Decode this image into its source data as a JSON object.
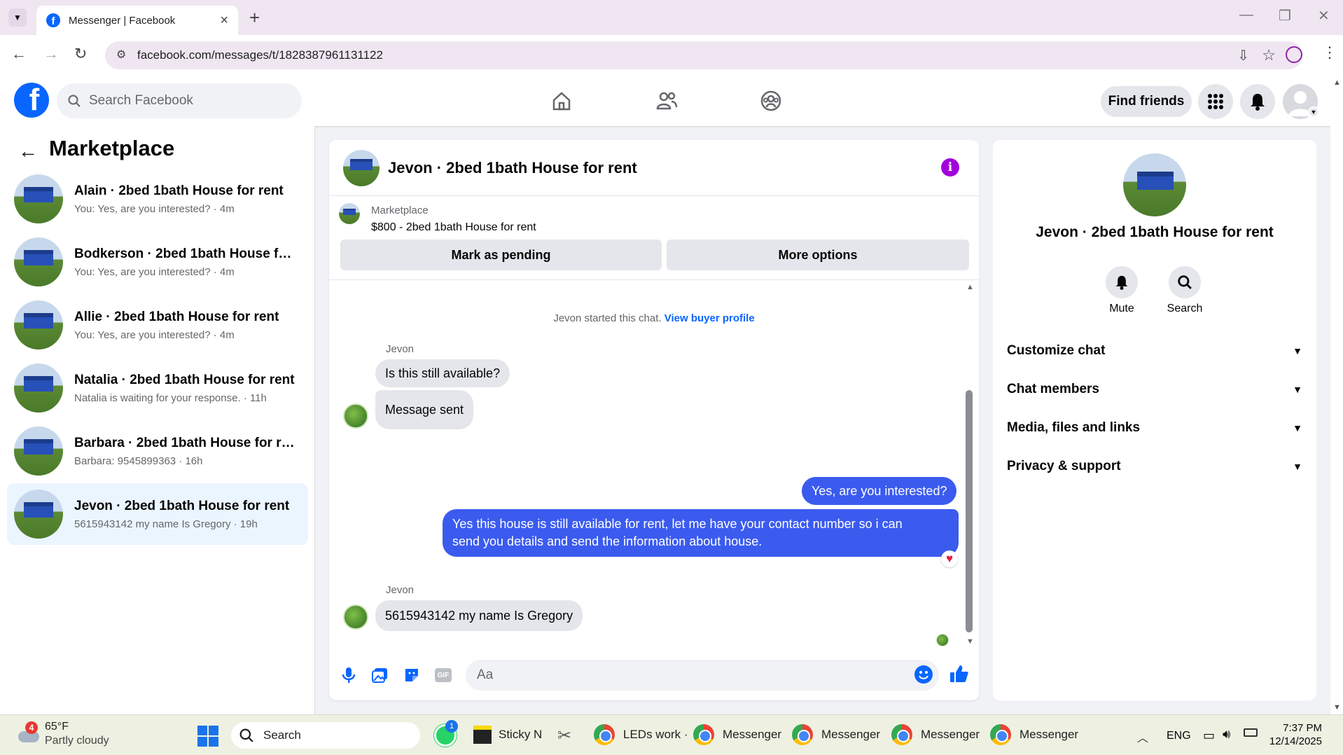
{
  "browser": {
    "tab_title": "Messenger | Facebook",
    "url": "facebook.com/messages/t/1828387961131122"
  },
  "header": {
    "search_placeholder": "Search Facebook",
    "find_friends": "Find friends",
    "brand_color": "#0866ff"
  },
  "sidebar": {
    "title": "Marketplace",
    "conversations": [
      {
        "name": "Alain · 2bed 1bath House for rent",
        "preview": "You: Yes, are you interested? · 4m"
      },
      {
        "name": "Bodkerson · 2bed 1bath House for ...",
        "preview": "You: Yes, are you interested? · 4m"
      },
      {
        "name": "Allie · 2bed 1bath House for rent",
        "preview": "You: Yes, are you interested? · 4m"
      },
      {
        "name": "Natalia · 2bed 1bath House for rent",
        "preview": "Natalia is waiting for your response. · 11h"
      },
      {
        "name": "Barbara · 2bed 1bath House for rent",
        "preview": "Barbara: 9545899363 · 16h"
      },
      {
        "name": "Jevon · 2bed 1bath House for rent",
        "preview": "5615943142 my name Is Gregory · 19h",
        "active": true
      }
    ]
  },
  "chat": {
    "title": "Jevon · 2bed 1bath House for rent",
    "marketplace_label": "Marketplace",
    "listing": "$800 - 2bed 1bath House for rent",
    "mark_pending": "Mark as pending",
    "more_options": "More options",
    "system_message": "Jevon started this chat.",
    "view_buyer_profile": "View buyer profile",
    "messages": {
      "sender1": "Jevon",
      "m1": "Is this still available?",
      "m2": "Message sent",
      "m3": "Yes, are you interested?",
      "m4_line1": "Yes this house is still available for rent, let me have your contact number so i can",
      "m4_line2": "send you details and send the information about house.",
      "sender2": "Jevon",
      "m5": "5615943142 my name Is Gregory"
    },
    "composer_placeholder": "Aa",
    "gif_label": "GIF",
    "outgoing_color": "#3b5bef"
  },
  "details": {
    "name": "Jevon · 2bed 1bath House for rent",
    "mute": "Mute",
    "search": "Search",
    "sections": [
      "Customize chat",
      "Chat members",
      "Media, files and links",
      "Privacy & support"
    ]
  },
  "taskbar": {
    "weather_temp": "65°F",
    "weather_desc": "Partly cloudy",
    "weather_badge": "4",
    "search": "Search",
    "whatsapp_badge": "1",
    "sticky": "Sticky N",
    "leds": "LEDs work ·",
    "messenger": "Messenger",
    "lang": "ENG",
    "time": "7:37 PM",
    "date": "12/14/2025"
  }
}
